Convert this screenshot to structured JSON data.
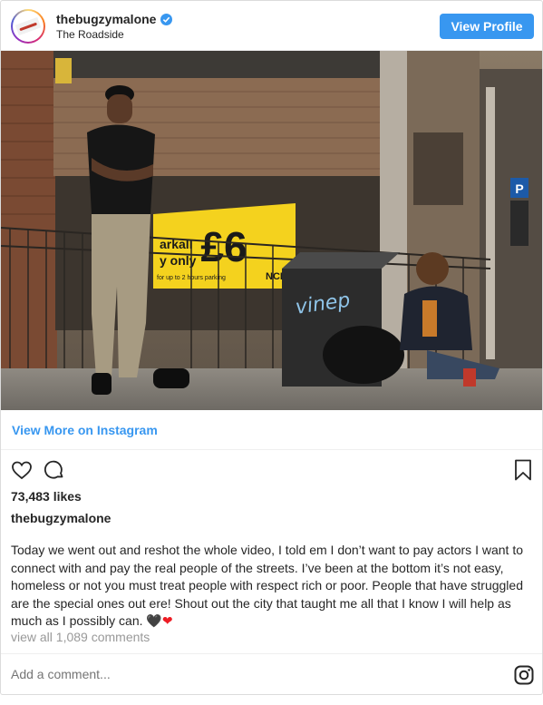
{
  "header": {
    "username": "thebugzymalone",
    "location": "The Roadside",
    "view_profile_label": "View Profile"
  },
  "photo": {
    "alt": "thebugzymalone post photo",
    "sign_large": "£6",
    "sign_lines": [
      "arkall",
      "y only"
    ],
    "sign_small": "for up to 2 hours parking",
    "sign_ncp": "NCP",
    "graffiti": "vinep"
  },
  "view_more_label": "View More on Instagram",
  "likes": "73,483 likes",
  "caption": {
    "username": "thebugzymalone",
    "text": "Today we went out and reshot the whole video, I told em I don’t want to pay actors I want to connect with and pay the real people of the streets. I’ve been at the bottom it’s not easy, homeless or not you must treat people with respect rich or poor. People that have struggled are the special ones out ere! Shout out the city that taught me all that I know I will help as much as I possibly can.",
    "heart_black": "🖤",
    "heart_red": "❤"
  },
  "comments_link": "view all 1,089 comments",
  "add_comment_placeholder": "Add a comment...",
  "icons": [
    "verified-badge-icon",
    "heart-icon",
    "comment-icon",
    "bookmark-icon",
    "instagram-icon"
  ],
  "colors": {
    "accent": "#3897f0",
    "text": "#262626",
    "muted": "#999999",
    "border": "#dbdbdb"
  }
}
